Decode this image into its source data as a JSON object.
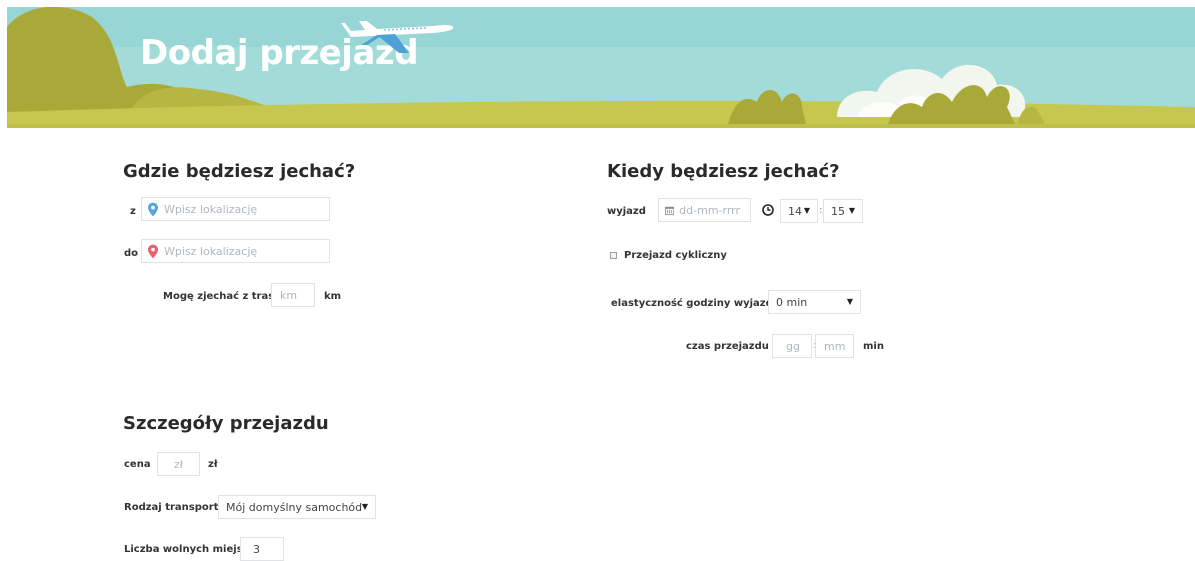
{
  "header": {
    "title": "Dodaj przejazd",
    "icon": "airplane-icon"
  },
  "where": {
    "heading": "Gdzie będziesz jechać?",
    "from_label": "z",
    "from_placeholder": "Wpisz lokalizację",
    "from_icon": "location-pin-blue-icon",
    "to_label": "do",
    "to_placeholder": "Wpisz lokalizację",
    "to_icon": "location-pin-red-icon",
    "detour_label": "Mogę zjechać z trasy",
    "detour_placeholder": "km",
    "detour_unit": "km"
  },
  "when": {
    "heading": "Kiedy będziesz jechać?",
    "departure_label": "wyjazd",
    "date_placeholder": "dd-mm-rrrr",
    "hour_value": "14",
    "minute_value": "15",
    "time_separator": ":",
    "recurring_label": "Przejazd cykliczny",
    "flexibility_label": "elastyczność godziny wyjazdu",
    "flexibility_value": "0 min",
    "duration_label": "czas przejazdu",
    "hours_placeholder": "gg",
    "minutes_placeholder": "mm",
    "duration_separator": ":",
    "duration_unit": "min"
  },
  "details": {
    "heading": "Szczegóły przejazdu",
    "price_label": "cena",
    "price_placeholder": "zł",
    "price_unit": "zł",
    "transport_label": "Rodzaj transportu",
    "transport_value": "Mój domyślny samochód",
    "seats_label": "Liczba wolnych miejsc",
    "seats_value": "3"
  },
  "colors": {
    "sky": "#a3dbd9",
    "grass": "#c6c74f",
    "bush": "#a8a83a",
    "pin_blue": "#5aa6d8",
    "pin_red": "#e8616b"
  }
}
